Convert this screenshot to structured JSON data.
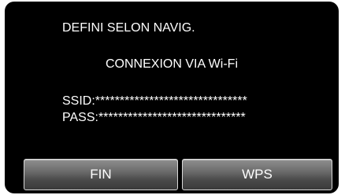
{
  "screen": {
    "title": "DEFINI SELON NAVIG.",
    "mode": "CONNEXION VIA Wi-Fi",
    "ssid_line": "SSID:*******************************",
    "pass_line": "PASS:******************************"
  },
  "buttons": {
    "fin_label": "FIN",
    "wps_label": "WPS"
  },
  "colors": {
    "background": "#000000",
    "text": "#ffffff",
    "button_border": "#d9d9d9"
  }
}
